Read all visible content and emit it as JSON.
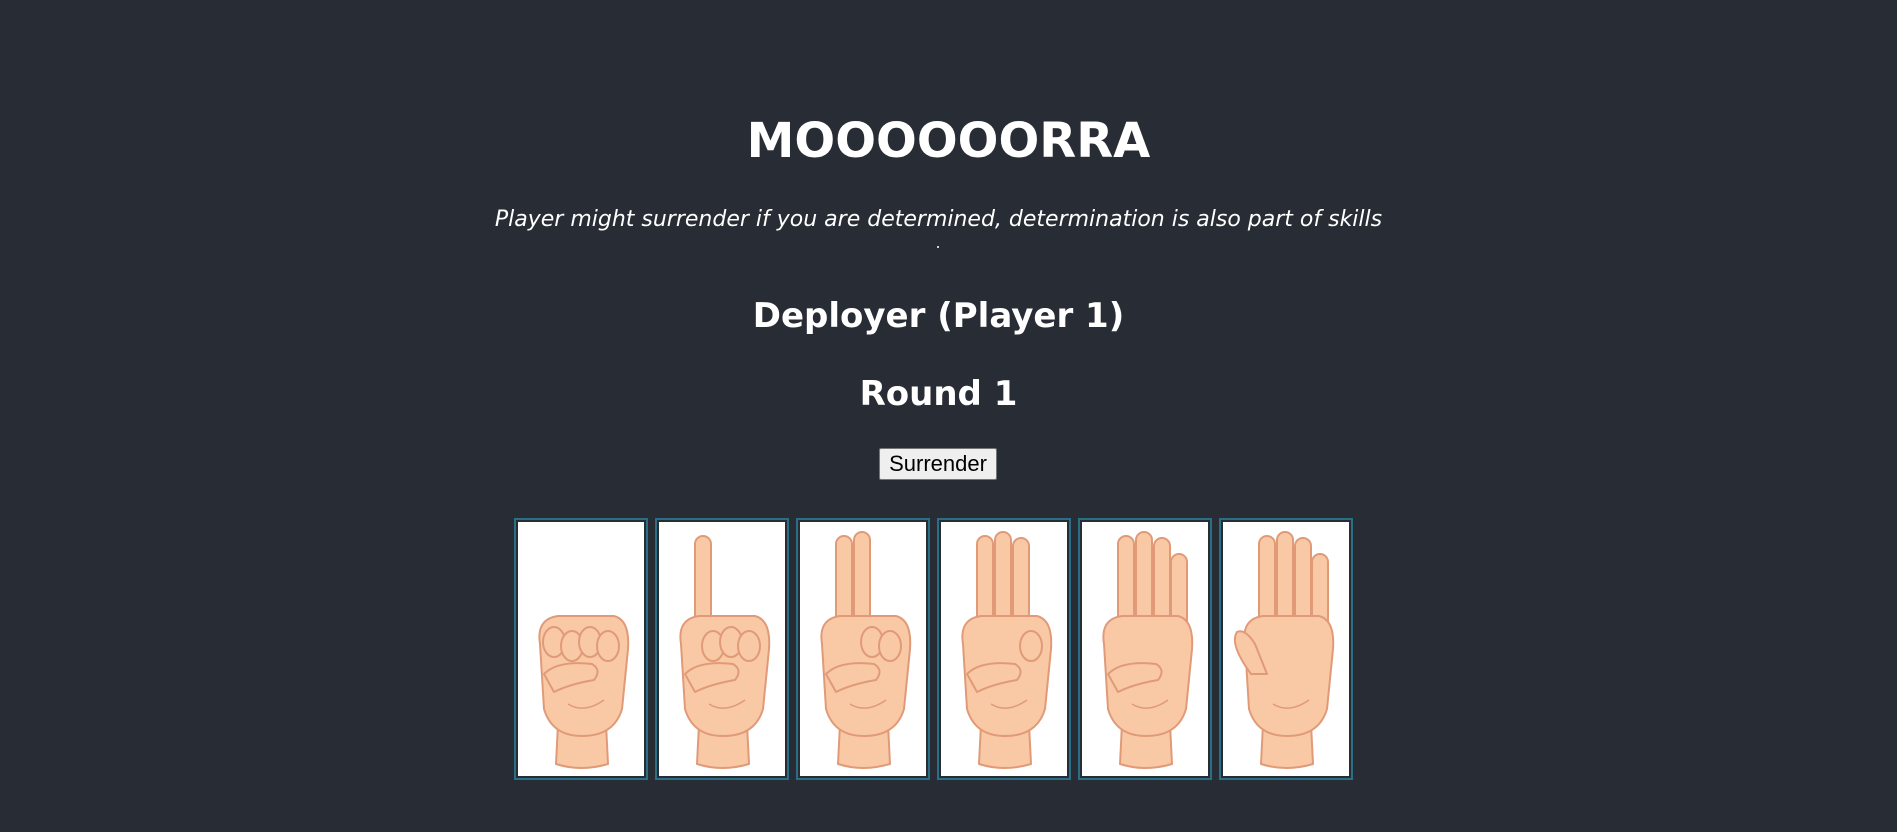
{
  "game": {
    "title": "MOOOOOORRA",
    "subtitle": "Player might surrender if you are determined, determination is also part of skills",
    "player_label": "Deployer (Player 1)",
    "round_label": "Round 1",
    "surrender_label": "Surrender"
  },
  "cards": [
    {
      "name": "fist-card",
      "icon": "fist-icon",
      "fingers": 0
    },
    {
      "name": "one-finger-card",
      "icon": "one-finger-icon",
      "fingers": 1
    },
    {
      "name": "two-fingers-card",
      "icon": "two-fingers-icon",
      "fingers": 2
    },
    {
      "name": "three-fingers-card",
      "icon": "three-fingers-icon",
      "fingers": 3
    },
    {
      "name": "four-fingers-card",
      "icon": "four-fingers-icon",
      "fingers": 4
    },
    {
      "name": "five-fingers-card",
      "icon": "five-fingers-icon",
      "fingers": 5
    }
  ],
  "colors": {
    "background": "#282c34",
    "card_border": "#2a6f86",
    "skin": "#f9c9a6",
    "skin_outline": "#e19a78"
  }
}
